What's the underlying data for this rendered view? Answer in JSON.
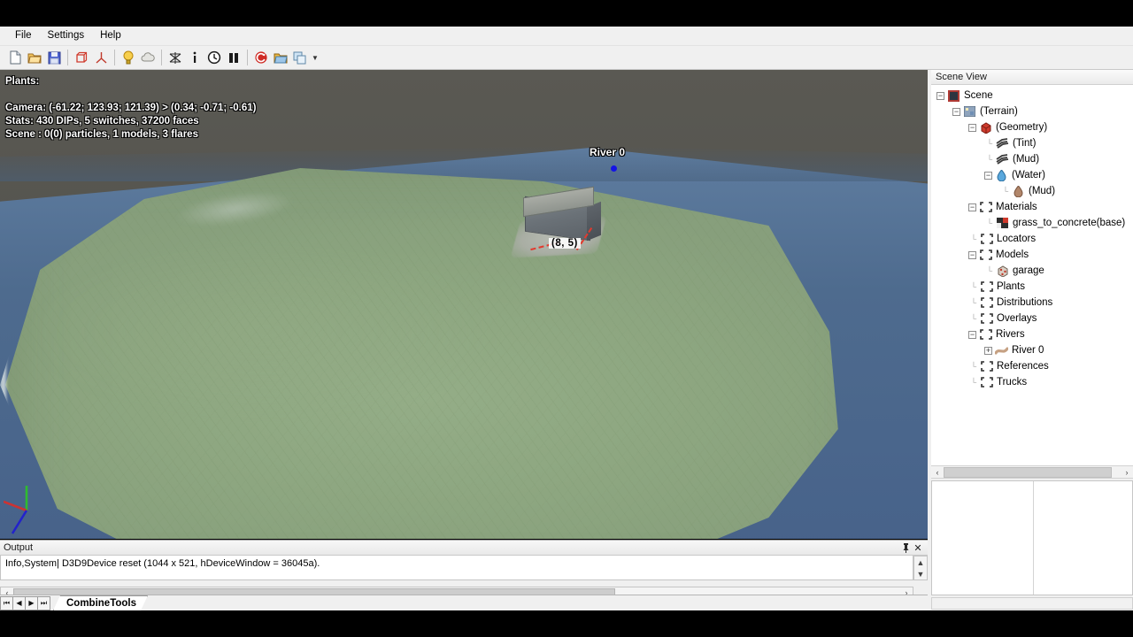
{
  "app": {
    "menu": [
      "File",
      "Settings",
      "Help"
    ],
    "toolbar_groups": [
      [
        {
          "name": "new-document-icon",
          "glyph": "⬜",
          "title": "New"
        },
        {
          "name": "open-folder-icon",
          "glyph": "📂",
          "title": "Open"
        },
        {
          "name": "save-disk-icon",
          "glyph": "💾",
          "title": "Save"
        }
      ],
      [
        {
          "name": "bounding-box-icon",
          "glyph": "□",
          "title": "Box"
        },
        {
          "name": "pivot-axis-icon",
          "glyph": "⤴",
          "title": "Axis"
        }
      ],
      [
        {
          "name": "light-bulb-icon",
          "glyph": "💡",
          "title": "Light"
        },
        {
          "name": "cloud-icon",
          "glyph": "☁",
          "title": "Cloud"
        }
      ],
      [
        {
          "name": "wireframe-icon",
          "glyph": "⨉",
          "title": "Wireframe"
        },
        {
          "name": "info-icon",
          "glyph": "i",
          "title": "Info"
        },
        {
          "name": "clock-icon",
          "glyph": "🕓",
          "title": "Timer"
        },
        {
          "name": "pause-icon",
          "glyph": "▐▌",
          "title": "Pause"
        }
      ],
      [
        {
          "name": "reload-icon",
          "glyph": "↺",
          "title": "Reload"
        },
        {
          "name": "open-scene-icon",
          "glyph": "📁",
          "title": "Open Scene"
        },
        {
          "name": "copy-icon",
          "glyph": "⧉",
          "title": "Copy"
        }
      ]
    ],
    "toolbar_overflow_glyph": "▼"
  },
  "viewport": {
    "hud": {
      "plants_label": "Plants:",
      "camera": "Camera: (-61.22; 123.93; 121.39) > (0.34; -0.71; -0.61)",
      "stats": "Stats: 430 DIPs, 5 switches, 37200 faces",
      "scene": "Scene : 0(0) particles, 1 models, 3 flares"
    },
    "river_label": "River 0",
    "model_label": "(8, 5)",
    "colors": {
      "background": "#54534e",
      "water": "#4e6b8e",
      "grass": "#8da680",
      "foam": "#ecf2ee",
      "selection": "#e23a2e",
      "marker": "#1414e6",
      "axis_x": "#cc3333",
      "axis_y": "#2fbb2f",
      "axis_z": "#2222cc"
    }
  },
  "output": {
    "title": "Output",
    "pin_glyph": "⚓",
    "close_glyph": "✕",
    "lines": [
      "Info,System| D3D9Device reset (1044 x 521, hDeviceWindow = 36045a)."
    ],
    "scroll_up_glyph": "▲",
    "scroll_down_glyph": "▼",
    "scroll_left_glyph": "‹",
    "scroll_right_glyph": "›"
  },
  "tabstrip": {
    "nav": [
      {
        "name": "tab-first-button",
        "glyph": "⏮"
      },
      {
        "name": "tab-prev-button",
        "glyph": "◀"
      },
      {
        "name": "tab-next-button",
        "glyph": "▶"
      },
      {
        "name": "tab-last-button",
        "glyph": "⏭"
      }
    ],
    "tabs": [
      {
        "label": "CombineTools",
        "active": true
      }
    ]
  },
  "scene_view": {
    "title": "Scene View",
    "scroll_left_glyph": "‹",
    "scroll_right_glyph": "›",
    "nodes": [
      {
        "label": "Scene",
        "depth": 0,
        "toggle": "minus",
        "icon": "scene-icon"
      },
      {
        "label": "(Terrain)",
        "depth": 1,
        "toggle": "minus",
        "icon": "terrain-icon"
      },
      {
        "label": "(Geometry)",
        "depth": 2,
        "toggle": "minus",
        "icon": "geometry-cube-icon"
      },
      {
        "label": "(Tint)",
        "depth": 3,
        "toggle": "none",
        "icon": "layers-icon"
      },
      {
        "label": "(Mud)",
        "depth": 3,
        "toggle": "none",
        "icon": "layers-icon"
      },
      {
        "label": "(Water)",
        "depth": 3,
        "toggle": "minus",
        "icon": "water-drop-icon"
      },
      {
        "label": "(Mud)",
        "depth": 4,
        "toggle": "none",
        "icon": "mud-drop-icon"
      },
      {
        "label": "Materials",
        "depth": 2,
        "toggle": "minus",
        "icon": "folder-dashed-icon"
      },
      {
        "label": "grass_to_concrete(base)",
        "depth": 3,
        "toggle": "none",
        "icon": "material-swatch-icon"
      },
      {
        "label": "Locators",
        "depth": 2,
        "toggle": "none",
        "icon": "folder-dashed-icon"
      },
      {
        "label": "Models",
        "depth": 2,
        "toggle": "minus",
        "icon": "folder-dashed-icon"
      },
      {
        "label": "garage",
        "depth": 3,
        "toggle": "none",
        "icon": "model-cube-icon"
      },
      {
        "label": "Plants",
        "depth": 2,
        "toggle": "none",
        "icon": "folder-dashed-icon"
      },
      {
        "label": "Distributions",
        "depth": 2,
        "toggle": "none",
        "icon": "folder-dashed-icon"
      },
      {
        "label": "Overlays",
        "depth": 2,
        "toggle": "none",
        "icon": "folder-dashed-icon"
      },
      {
        "label": "Rivers",
        "depth": 2,
        "toggle": "minus",
        "icon": "folder-dashed-icon"
      },
      {
        "label": "River 0",
        "depth": 3,
        "toggle": "plus",
        "icon": "river-icon"
      },
      {
        "label": "References",
        "depth": 2,
        "toggle": "none",
        "icon": "folder-dashed-icon"
      },
      {
        "label": "Trucks",
        "depth": 2,
        "toggle": "none",
        "icon": "folder-dashed-icon"
      }
    ]
  }
}
